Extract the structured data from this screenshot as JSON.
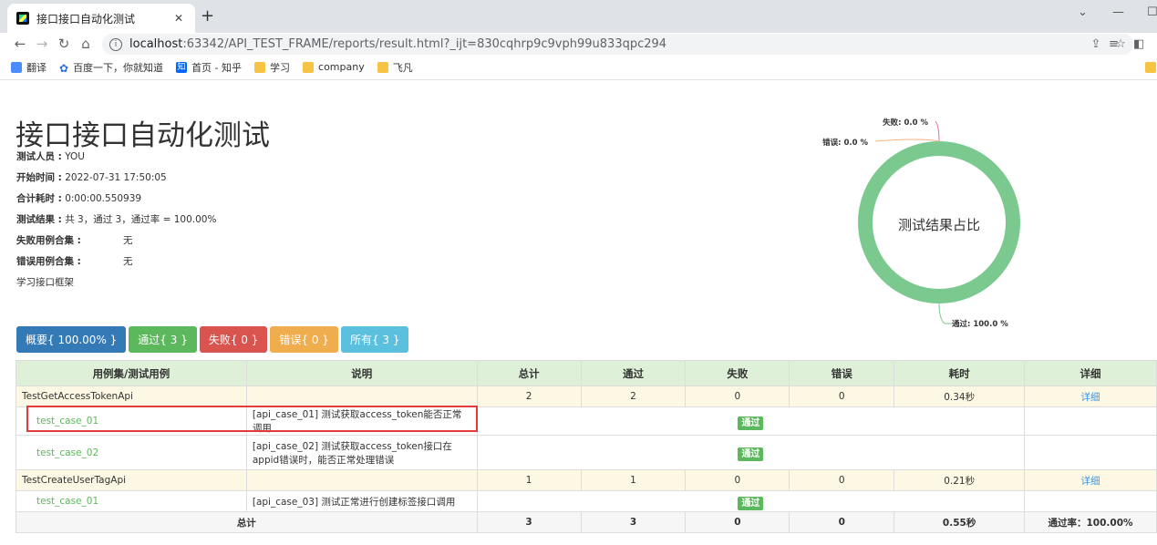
{
  "browser": {
    "tab_title": "接口接口自动化测试",
    "tab_close": "✕",
    "new_tab": "+",
    "url_host": "localhost",
    "url_path": ":63342/API_TEST_FRAME/reports/result.html?_ijt=830cqhrp9c9vph99u833qpc294",
    "bookmarks": [
      "翻译",
      "百度一下，你就知道",
      "首页 - 知乎",
      "学习",
      "company",
      "飞凡"
    ]
  },
  "report": {
    "title": "接口接口自动化测试",
    "tester_label": "测试人员 :",
    "tester": "YOU",
    "start_label": "开始时间 :",
    "start": "2022-07-31 17:50:05",
    "duration_label": "合计耗时 :",
    "duration": "0:00:00.550939",
    "result_label": "测试结果 :",
    "result": "共 3，通过 3，通过率 = 100.00%",
    "failed_label": "失败用例合集 :",
    "failed": "无",
    "error_label": "错误用例合集 :",
    "error": "无",
    "description": "学习接口框架"
  },
  "buttons": {
    "summary": "概要{ 100.00% }",
    "pass": "通过{ 3 }",
    "fail": "失败{ 0 }",
    "error": "错误{ 0 }",
    "all": "所有{ 3 }"
  },
  "chart_data": {
    "type": "pie",
    "title": "测试结果占比",
    "categories": [
      "通过",
      "失败",
      "错误"
    ],
    "values": [
      100.0,
      0.0,
      0.0
    ],
    "labels": [
      "通过: 100.0 %",
      "失败: 0.0 %",
      "错误: 0.0 %"
    ],
    "colors": [
      "#7cc98f",
      "#e96f8a",
      "#f4b183"
    ]
  },
  "table": {
    "headers": [
      "用例集/测试用例",
      "说明",
      "总计",
      "通过",
      "失败",
      "错误",
      "耗时",
      "详细"
    ],
    "suite1": {
      "name": "TestGetAccessTokenApi",
      "total": "2",
      "pass": "2",
      "fail": "0",
      "error": "0",
      "time": "0.34秒",
      "detail": "详细"
    },
    "case1": {
      "name": "test_case_01",
      "desc": "[api_case_01] 测试获取access_token能否正常调用",
      "status": "通过"
    },
    "case2": {
      "name": "test_case_02",
      "desc": "[api_case_02] 测试获取access_token接口在appid错误时，能否正常处理错误",
      "status": "通过"
    },
    "suite2": {
      "name": "TestCreateUserTagApi",
      "total": "1",
      "pass": "1",
      "fail": "0",
      "error": "0",
      "time": "0.21秒",
      "detail": "详细"
    },
    "case3": {
      "name": "test_case_01",
      "desc": "[api_case_03] 测试正常进行创建标签接口调用",
      "status": "通过"
    },
    "total": {
      "label": "总计",
      "total": "3",
      "pass": "3",
      "fail": "0",
      "error": "0",
      "time": "0.55秒",
      "rate": "通过率：100.00%"
    }
  }
}
